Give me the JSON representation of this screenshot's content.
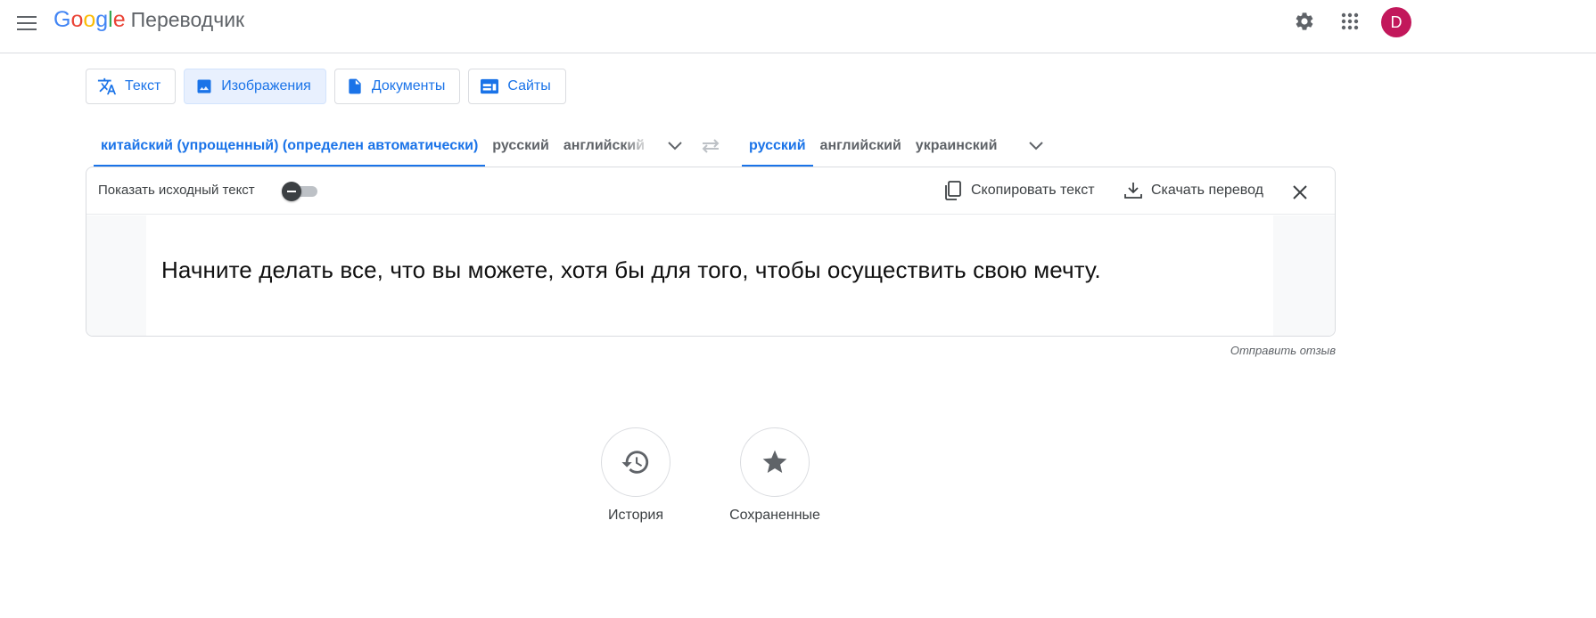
{
  "app": {
    "logo_letters": [
      "G",
      "o",
      "o",
      "g",
      "l",
      "e"
    ],
    "product": "Переводчик",
    "avatar_letter": "D"
  },
  "colors": {
    "accent": "#1a73e8",
    "active_tab_bg": "#e8f0fe",
    "avatar": "#c2185b"
  },
  "mode_tabs": [
    {
      "label": "Текст",
      "icon": "translate-icon",
      "active": false
    },
    {
      "label": "Изображения",
      "icon": "image-icon",
      "active": true
    },
    {
      "label": "Документы",
      "icon": "document-icon",
      "active": false
    },
    {
      "label": "Сайты",
      "icon": "website-icon",
      "active": false
    }
  ],
  "source_langs": [
    {
      "label": "китайский (упрощенный) (определен автоматически)",
      "active": true
    },
    {
      "label": "русский",
      "active": false
    },
    {
      "label": "английский",
      "active": false
    }
  ],
  "target_langs": [
    {
      "label": "русский",
      "active": true
    },
    {
      "label": "английский",
      "active": false
    },
    {
      "label": "украинский",
      "active": false
    }
  ],
  "panel": {
    "show_source_label": "Показать исходный текст",
    "show_source_on": false,
    "copy_label": "Скопировать текст",
    "download_label": "Скачать перевод",
    "translated_text": "Начните делать все, что вы можете, хотя бы для того, чтобы осуществить свою мечту."
  },
  "feedback_label": "Отправить отзыв",
  "bottom": {
    "history_label": "История",
    "saved_label": "Сохраненные"
  },
  "icons": {
    "menu": "menu-icon",
    "settings": "gear-icon",
    "apps": "apps-grid-icon",
    "swap": "swap-icon",
    "expand": "chevron-down-icon",
    "copy": "copy-icon",
    "download": "download-icon",
    "close": "close-icon",
    "history": "history-icon",
    "saved": "star-icon"
  }
}
